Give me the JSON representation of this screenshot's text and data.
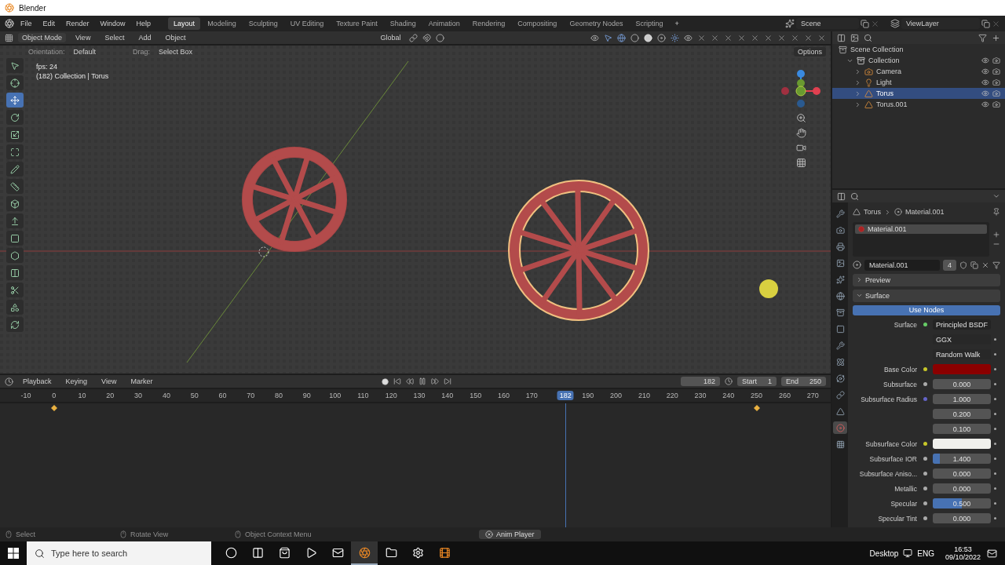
{
  "window": {
    "title": "Blender"
  },
  "menu": [
    "File",
    "Edit",
    "Render",
    "Window",
    "Help"
  ],
  "workspaces": [
    {
      "label": "Layout",
      "selected": true
    },
    {
      "label": "Modeling",
      "selected": false
    },
    {
      "label": "Sculpting",
      "selected": false
    },
    {
      "label": "UV Editing",
      "selected": false
    },
    {
      "label": "Texture Paint",
      "selected": false
    },
    {
      "label": "Shading",
      "selected": false
    },
    {
      "label": "Animation",
      "selected": false
    },
    {
      "label": "Rendering",
      "selected": false
    },
    {
      "label": "Compositing",
      "selected": false
    },
    {
      "label": "Geometry Nodes",
      "selected": false
    },
    {
      "label": "Scripting",
      "selected": false
    }
  ],
  "add_workspace": "+",
  "scene": "Scene",
  "view_layer": "ViewLayer",
  "viewport": {
    "mode": "Object Mode",
    "menus": [
      "View",
      "Select",
      "Add",
      "Object"
    ],
    "transform": "Global",
    "orientation_label": "Orientation:",
    "orientation": "Default",
    "drag_label": "Drag:",
    "drag": "Select Box",
    "options": "Options",
    "overlay_lines": [
      "fps: 24",
      "(182) Collection | Torus"
    ]
  },
  "tools": [
    {
      "kind": "select",
      "selected": false
    },
    {
      "kind": "cursor",
      "selected": false
    },
    {
      "kind": "move",
      "selected": true
    },
    {
      "kind": "rotate",
      "selected": false
    },
    {
      "kind": "scale",
      "selected": false
    },
    {
      "kind": "transform",
      "selected": false
    },
    {
      "kind": "annotate",
      "selected": false
    },
    {
      "kind": "measure",
      "selected": false
    },
    {
      "kind": "add",
      "selected": false
    },
    {
      "kind": "extrude",
      "selected": false
    },
    {
      "kind": "inset",
      "selected": false
    },
    {
      "kind": "bevel",
      "selected": false
    },
    {
      "kind": "loopcut",
      "selected": false
    },
    {
      "kind": "knife",
      "selected": false
    },
    {
      "kind": "polybuild",
      "selected": false
    },
    {
      "kind": "spin",
      "selected": false
    }
  ],
  "outliner": [
    {
      "label": "Scene Collection",
      "kind": "scene",
      "selected": false,
      "children": [
        {
          "label": "Collection",
          "kind": "collection",
          "selected": false,
          "expanded": true,
          "children": [
            {
              "label": "Camera",
              "kind": "camera",
              "selected": false,
              "expanded": false
            },
            {
              "label": "Light",
              "kind": "light",
              "selected": false,
              "expanded": false
            },
            {
              "label": "Torus",
              "kind": "mesh",
              "selected": true,
              "expanded": false
            },
            {
              "label": "Torus.001",
              "kind": "mesh",
              "selected": false,
              "expanded": false
            }
          ]
        }
      ]
    }
  ],
  "property_tabs": [
    {
      "kind": "tool",
      "selected": false
    },
    {
      "kind": "render",
      "selected": false
    },
    {
      "kind": "output",
      "selected": false
    },
    {
      "kind": "view",
      "selected": false
    },
    {
      "kind": "scene",
      "selected": false
    },
    {
      "kind": "world",
      "selected": false
    },
    {
      "kind": "collection",
      "selected": false
    },
    {
      "kind": "object",
      "selected": false
    },
    {
      "kind": "modifier",
      "selected": false
    },
    {
      "kind": "particles",
      "selected": false
    },
    {
      "kind": "physics",
      "selected": false
    },
    {
      "kind": "constraints",
      "selected": false
    },
    {
      "kind": "data",
      "selected": false
    },
    {
      "kind": "material",
      "selected": true
    },
    {
      "kind": "texture",
      "selected": false
    }
  ],
  "properties": {
    "breadcrumb": [
      "Torus",
      "Material.001"
    ],
    "slots": [
      {
        "label": "Material.001",
        "selected": true
      }
    ],
    "material": "Material.001",
    "users": "4",
    "panels": [
      {
        "label": "Preview",
        "expanded": false
      },
      {
        "label": "Surface",
        "expanded": true
      }
    ],
    "use_nodes": "Use Nodes",
    "surface_label": "Surface",
    "surface": "Principled BSDF",
    "rows": [
      {
        "kind": "dropdown",
        "value": "GGX"
      },
      {
        "kind": "dropdown",
        "value": "Random Walk"
      },
      {
        "kind": "color",
        "label": "Base Color",
        "color": "#8b0000"
      },
      {
        "kind": "number",
        "label": "Subsurface",
        "value": "0.000"
      },
      {
        "kind": "vector",
        "label": "Subsurface Radius",
        "values": [
          "1.000",
          "0.200",
          "0.100"
        ]
      },
      {
        "kind": "color",
        "label": "Subsurface Color",
        "color": "#f0f0ec"
      },
      {
        "kind": "number",
        "label": "Subsurface IOR",
        "value": "1.400",
        "level": 0.12
      },
      {
        "kind": "number",
        "label": "Subsurface Aniso...",
        "value": "0.000"
      },
      {
        "kind": "number",
        "label": "Metallic",
        "value": "0.000"
      },
      {
        "kind": "number",
        "label": "Specular",
        "value": "0.500",
        "level": 0.5
      },
      {
        "kind": "number",
        "label": "Specular Tint",
        "value": "0.000"
      }
    ]
  },
  "timeline": {
    "menus": [
      "Playback",
      "Keying",
      "View",
      "Marker"
    ],
    "current_frame": "182",
    "start_label": "Start",
    "start": "1",
    "end_label": "End",
    "end": "250",
    "playhead": "182",
    "ruler": [
      "-10",
      "0",
      "10",
      "20",
      "30",
      "40",
      "50",
      "60",
      "70",
      "80",
      "90",
      "100",
      "110",
      "120",
      "130",
      "140",
      "150",
      "160",
      "170",
      "190",
      "200",
      "210",
      "220",
      "230",
      "240",
      "250",
      "260",
      "270"
    ]
  },
  "status": {
    "items": [
      "Select",
      "Rotate View",
      "Object Context Menu"
    ],
    "notice": "Anim Player"
  },
  "taskbar": {
    "search_placeholder": "Type here to search",
    "apps": [
      {
        "kind": "cortana",
        "selected": false
      },
      {
        "kind": "taskview",
        "selected": false
      },
      {
        "kind": "store",
        "selected": false
      },
      {
        "kind": "media",
        "selected": false
      },
      {
        "kind": "mail",
        "selected": false
      },
      {
        "kind": "blender",
        "selected": true
      },
      {
        "kind": "explorer",
        "selected": false
      },
      {
        "kind": "settings",
        "selected": false
      },
      {
        "kind": "recorder",
        "selected": false
      }
    ],
    "desktop": "Desktop",
    "language": "ENG",
    "time": "16:53",
    "date": "09/10/2022"
  }
}
